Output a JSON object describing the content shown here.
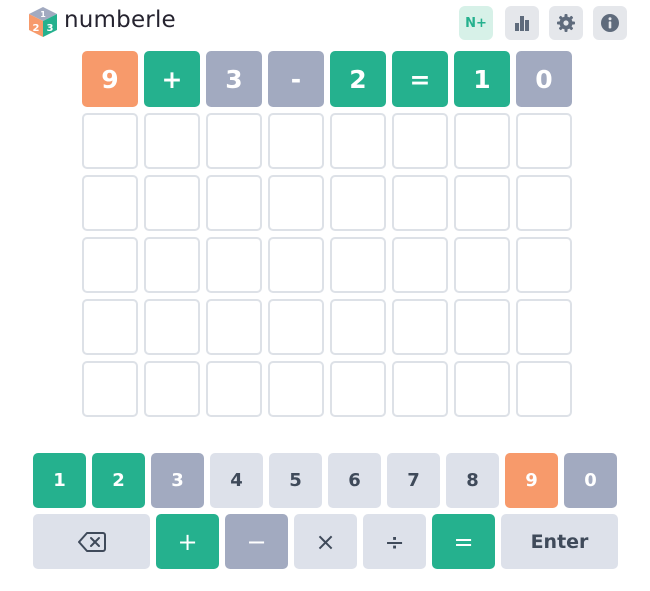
{
  "header": {
    "app_title": "numberle",
    "logo_digits": [
      "1",
      "2",
      "3"
    ],
    "nplus_label": "N+",
    "icons": [
      "stats-icon",
      "gear-icon",
      "info-icon"
    ]
  },
  "colors": {
    "correct": "#25b18e",
    "present": "#f79a6b",
    "absent": "#a2aac0",
    "empty_border": "#dde1e7",
    "key_default": "#dde1ea"
  },
  "board": {
    "rows": [
      [
        {
          "char": "9",
          "state": "present"
        },
        {
          "char": "+",
          "state": "correct"
        },
        {
          "char": "3",
          "state": "absent"
        },
        {
          "char": "-",
          "state": "absent"
        },
        {
          "char": "2",
          "state": "correct"
        },
        {
          "char": "=",
          "state": "correct"
        },
        {
          "char": "1",
          "state": "correct"
        },
        {
          "char": "0",
          "state": "absent"
        }
      ],
      [
        {
          "char": "",
          "state": "empty"
        },
        {
          "char": "",
          "state": "empty"
        },
        {
          "char": "",
          "state": "empty"
        },
        {
          "char": "",
          "state": "empty"
        },
        {
          "char": "",
          "state": "empty"
        },
        {
          "char": "",
          "state": "empty"
        },
        {
          "char": "",
          "state": "empty"
        },
        {
          "char": "",
          "state": "empty"
        }
      ],
      [
        {
          "char": "",
          "state": "empty"
        },
        {
          "char": "",
          "state": "empty"
        },
        {
          "char": "",
          "state": "empty"
        },
        {
          "char": "",
          "state": "empty"
        },
        {
          "char": "",
          "state": "empty"
        },
        {
          "char": "",
          "state": "empty"
        },
        {
          "char": "",
          "state": "empty"
        },
        {
          "char": "",
          "state": "empty"
        }
      ],
      [
        {
          "char": "",
          "state": "empty"
        },
        {
          "char": "",
          "state": "empty"
        },
        {
          "char": "",
          "state": "empty"
        },
        {
          "char": "",
          "state": "empty"
        },
        {
          "char": "",
          "state": "empty"
        },
        {
          "char": "",
          "state": "empty"
        },
        {
          "char": "",
          "state": "empty"
        },
        {
          "char": "",
          "state": "empty"
        }
      ],
      [
        {
          "char": "",
          "state": "empty"
        },
        {
          "char": "",
          "state": "empty"
        },
        {
          "char": "",
          "state": "empty"
        },
        {
          "char": "",
          "state": "empty"
        },
        {
          "char": "",
          "state": "empty"
        },
        {
          "char": "",
          "state": "empty"
        },
        {
          "char": "",
          "state": "empty"
        },
        {
          "char": "",
          "state": "empty"
        }
      ],
      [
        {
          "char": "",
          "state": "empty"
        },
        {
          "char": "",
          "state": "empty"
        },
        {
          "char": "",
          "state": "empty"
        },
        {
          "char": "",
          "state": "empty"
        },
        {
          "char": "",
          "state": "empty"
        },
        {
          "char": "",
          "state": "empty"
        },
        {
          "char": "",
          "state": "empty"
        },
        {
          "char": "",
          "state": "empty"
        }
      ]
    ]
  },
  "keyboard": {
    "digits": [
      {
        "label": "1",
        "state": "correct"
      },
      {
        "label": "2",
        "state": "correct"
      },
      {
        "label": "3",
        "state": "absent"
      },
      {
        "label": "4",
        "state": "default"
      },
      {
        "label": "5",
        "state": "default"
      },
      {
        "label": "6",
        "state": "default"
      },
      {
        "label": "7",
        "state": "default"
      },
      {
        "label": "8",
        "state": "default"
      },
      {
        "label": "9",
        "state": "present"
      },
      {
        "label": "0",
        "state": "absent"
      }
    ],
    "backspace_icon": "backspace-icon",
    "operators": [
      {
        "label": "+",
        "name": "plus",
        "state": "correct"
      },
      {
        "label": "−",
        "name": "minus",
        "state": "absent"
      },
      {
        "label": "×",
        "name": "multiply",
        "state": "default"
      },
      {
        "label": "÷",
        "name": "divide",
        "state": "default"
      },
      {
        "label": "=",
        "name": "equals",
        "state": "correct"
      }
    ],
    "enter_label": "Enter"
  }
}
